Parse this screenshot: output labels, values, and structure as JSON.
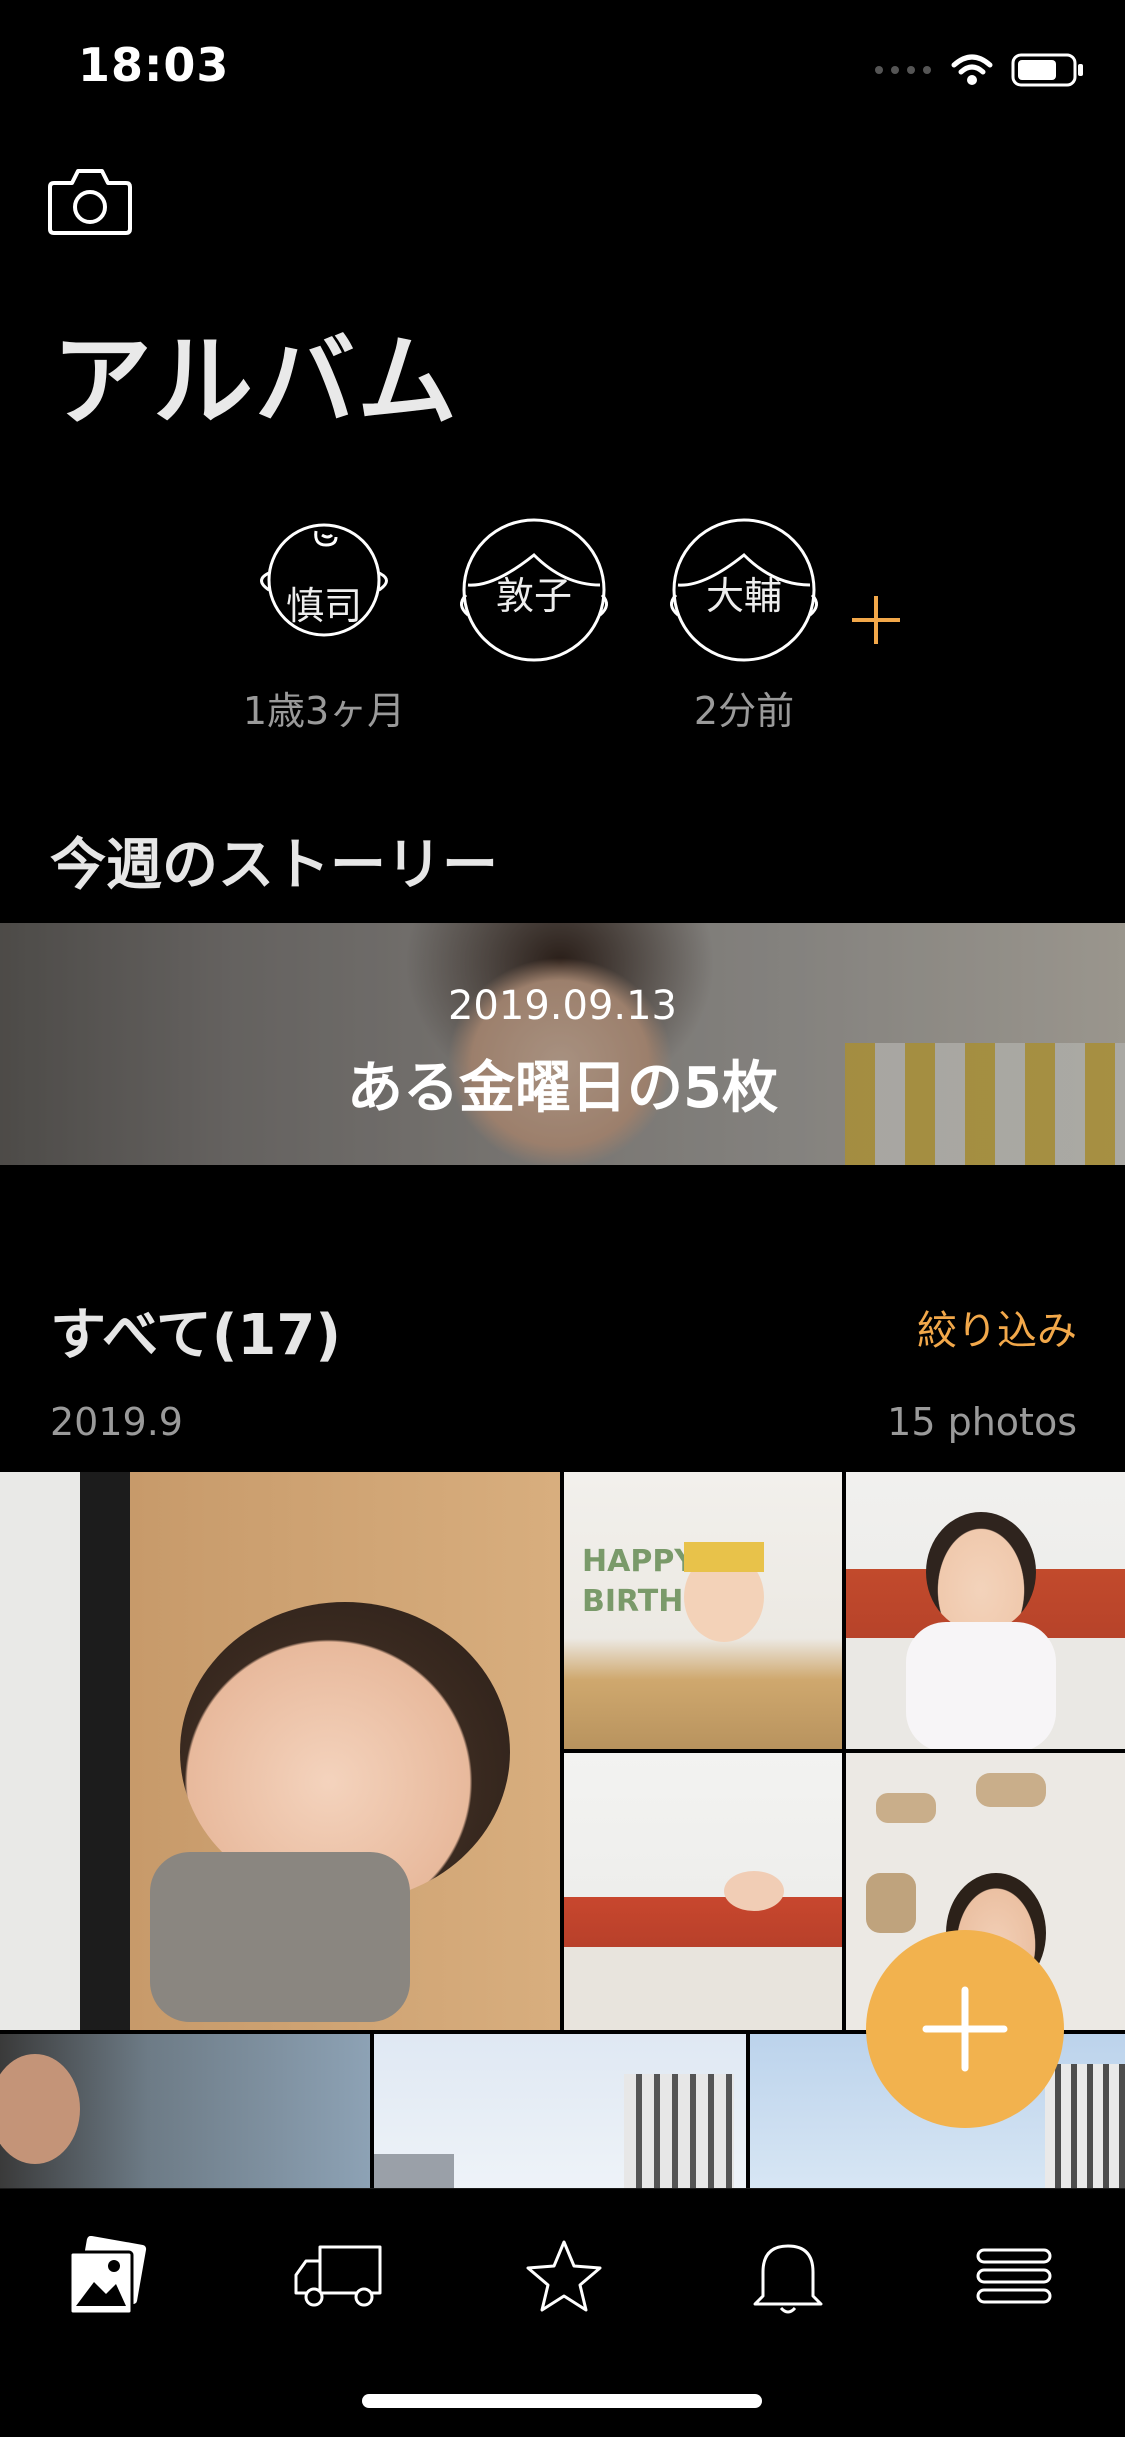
{
  "status_bar": {
    "time": "18:03"
  },
  "header": {
    "title": "アルバム"
  },
  "kids": [
    {
      "name": "慎司",
      "age": "1歳3ヶ月"
    },
    {
      "name": "敦子",
      "age": ""
    },
    {
      "name": "大輔",
      "age": "2分前"
    }
  ],
  "story": {
    "section_title": "今週のストーリー",
    "date": "2019.09.13",
    "title": "ある金曜日の5枚"
  },
  "all": {
    "title": "すべて(17)",
    "filter_label": "絞り込み",
    "month": "2019.9",
    "count": "15 photos",
    "birthday_banner": "HAPPY BIRTH"
  },
  "tabs": [
    {
      "name": "album",
      "icon": "photos-icon",
      "active": true
    },
    {
      "name": "delivery",
      "icon": "truck-icon",
      "active": false
    },
    {
      "name": "favorites",
      "icon": "star-icon",
      "active": false
    },
    {
      "name": "notifications",
      "icon": "bell-icon",
      "active": false
    },
    {
      "name": "menu",
      "icon": "menu-icon",
      "active": false
    }
  ],
  "colors": {
    "accent": "#f2a84a",
    "fab": "#f2b24e",
    "background": "#000000"
  }
}
